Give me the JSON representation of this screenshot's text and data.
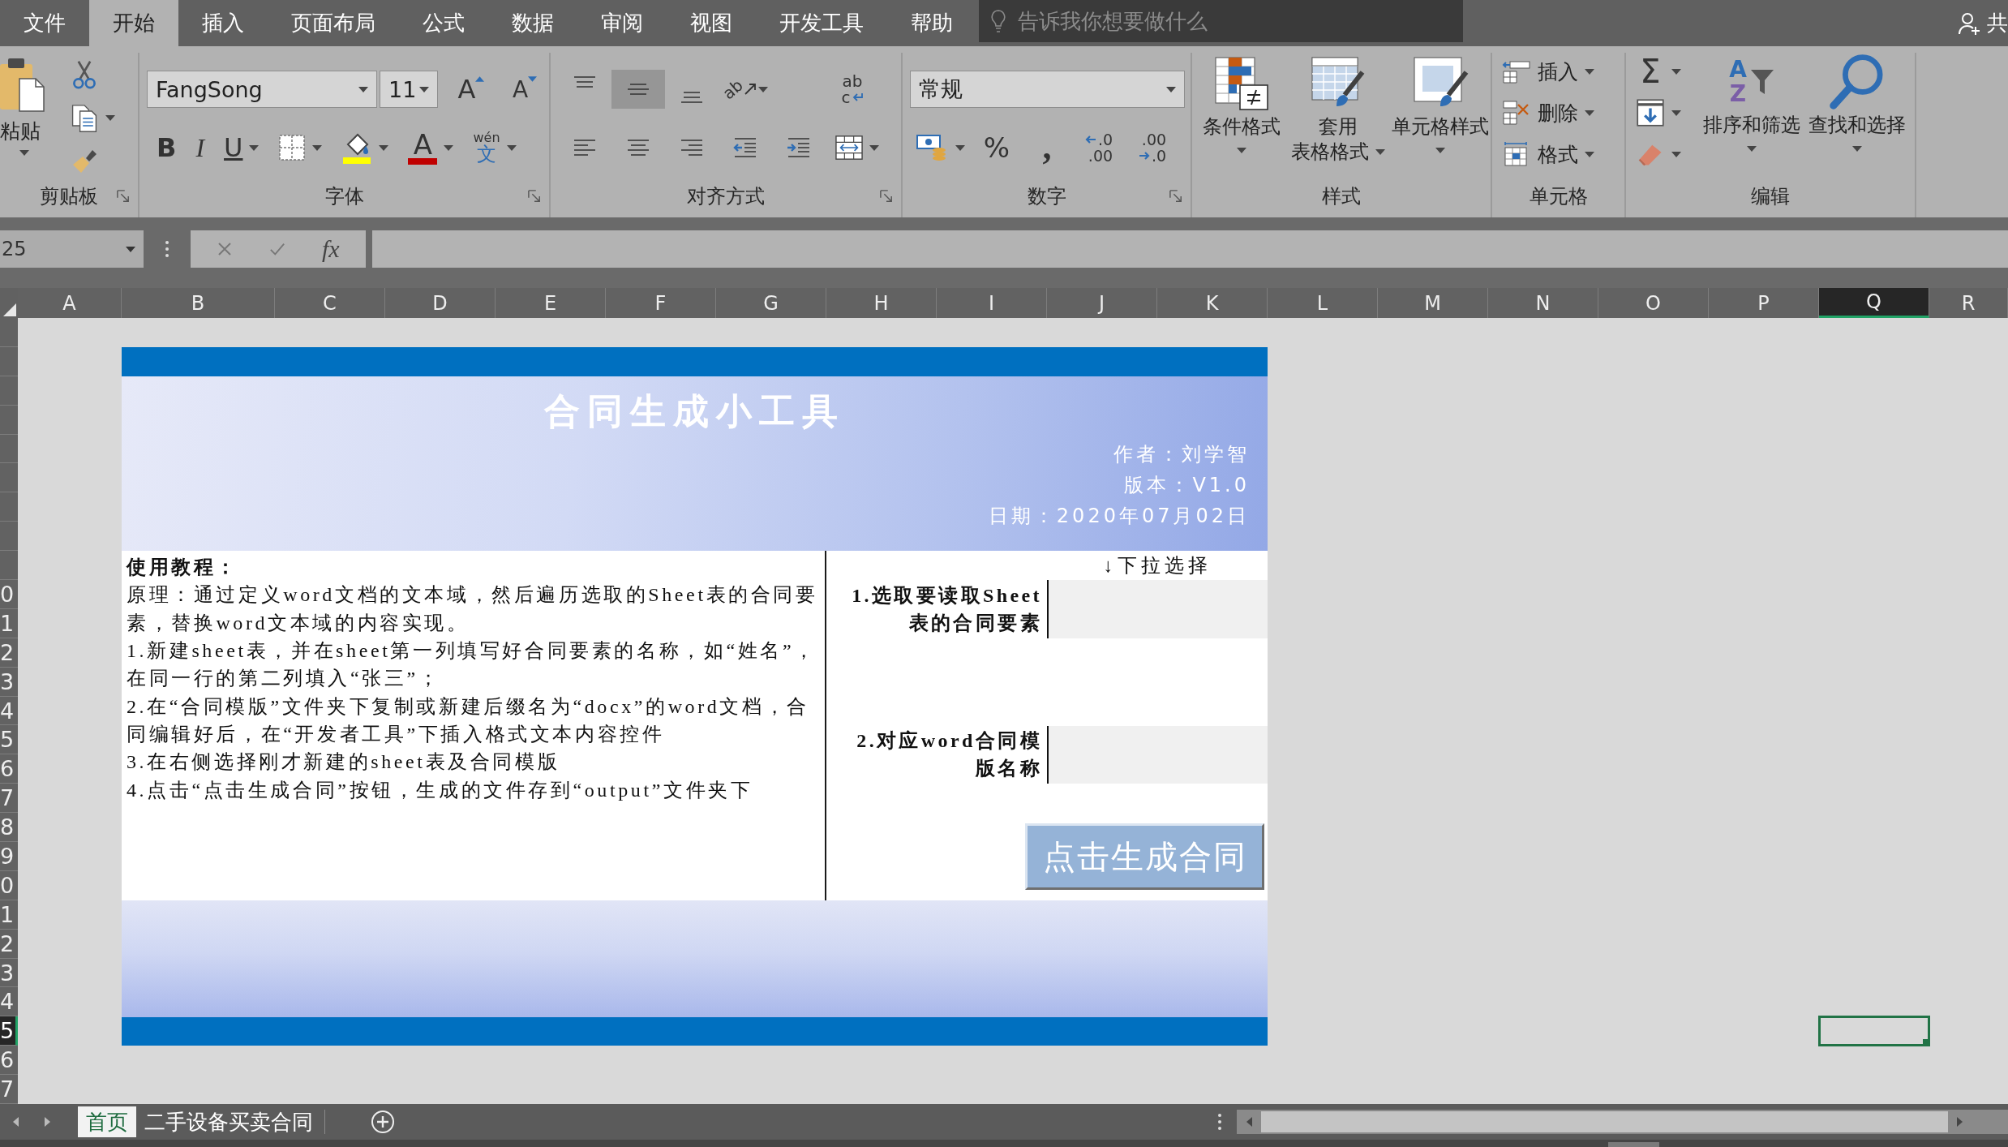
{
  "menu_tabs": [
    {
      "label": "文件",
      "selected": false
    },
    {
      "label": "开始",
      "selected": true
    },
    {
      "label": "插入",
      "selected": false
    },
    {
      "label": "页面布局",
      "selected": false
    },
    {
      "label": "公式",
      "selected": false
    },
    {
      "label": "数据",
      "selected": false
    },
    {
      "label": "审阅",
      "selected": false
    },
    {
      "label": "视图",
      "selected": false
    },
    {
      "label": "开发工具",
      "selected": false
    },
    {
      "label": "帮助",
      "selected": false
    }
  ],
  "tell_me": {
    "placeholder": "告诉我你想要做什么"
  },
  "share": {
    "label": "共"
  },
  "ribbon": {
    "clipboard": {
      "title": "剪贴板",
      "paste": "粘贴"
    },
    "font": {
      "title": "字体",
      "font_name": "FangSong",
      "font_size": "11",
      "grow": "A",
      "shrink": "A",
      "styles": [
        {
          "kind": "bold",
          "label": "B"
        },
        {
          "kind": "italic",
          "label": "I"
        },
        {
          "kind": "underline",
          "label": "U"
        }
      ],
      "font_color": "A",
      "phonetic": {
        "top": "wén",
        "bottom": "文"
      }
    },
    "alignment": {
      "title": "对齐方式",
      "vertical": [
        {
          "kind": "top",
          "selected": false
        },
        {
          "kind": "middle",
          "selected": true
        },
        {
          "kind": "bottom",
          "selected": false
        }
      ],
      "orientation": "ab",
      "wrap": {
        "top": "ab",
        "bottom": "c"
      }
    },
    "number": {
      "title": "数字",
      "format": "常规",
      "percent": "%",
      "comma": ",",
      "increase_decimal": {
        "top": ".0",
        "bottom": ".00"
      },
      "decrease_decimal": {
        "top": ".00",
        "bottom": ".0"
      }
    },
    "styles": {
      "title": "样式",
      "buttons": [
        {
          "kind": "conditional",
          "lines": [
            "条件格式"
          ]
        },
        {
          "kind": "table",
          "lines": [
            "套用",
            "表格格式"
          ]
        },
        {
          "kind": "cell",
          "lines": [
            "单元格样式"
          ]
        }
      ]
    },
    "cells": {
      "title": "单元格",
      "buttons": [
        {
          "kind": "insert",
          "label": "插入"
        },
        {
          "kind": "delete",
          "label": "删除"
        },
        {
          "kind": "format",
          "label": "格式"
        }
      ]
    },
    "editing": {
      "title": "编辑",
      "sum": "Σ",
      "sort": {
        "label": "排序和筛选",
        "top": "A",
        "bottom": "Z"
      },
      "find": "查找和选择"
    }
  },
  "formula_bar": {
    "name_box": "25",
    "fx": "fx"
  },
  "columns": [
    {
      "label": "A",
      "selected": false
    },
    {
      "label": "B",
      "selected": false
    },
    {
      "label": "C",
      "selected": false
    },
    {
      "label": "D",
      "selected": false
    },
    {
      "label": "E",
      "selected": false
    },
    {
      "label": "F",
      "selected": false
    },
    {
      "label": "G",
      "selected": false
    },
    {
      "label": "H",
      "selected": false
    },
    {
      "label": "I",
      "selected": false
    },
    {
      "label": "J",
      "selected": false
    },
    {
      "label": "K",
      "selected": false
    },
    {
      "label": "L",
      "selected": false
    },
    {
      "label": "M",
      "selected": false
    },
    {
      "label": "N",
      "selected": false
    },
    {
      "label": "O",
      "selected": false
    },
    {
      "label": "P",
      "selected": false
    },
    {
      "label": "Q",
      "selected": true
    },
    {
      "label": "R",
      "selected": false
    }
  ],
  "rows": [
    {
      "selected": false
    },
    {
      "selected": false
    },
    {
      "selected": false
    },
    {
      "selected": false
    },
    {
      "selected": false
    },
    {
      "selected": false
    },
    {
      "selected": false
    },
    {
      "selected": false
    },
    {
      "selected": false
    },
    {
      "label": "0",
      "selected": false
    },
    {
      "label": "1",
      "selected": false
    },
    {
      "label": "2",
      "selected": false
    },
    {
      "label": "3",
      "selected": false
    },
    {
      "label": "4",
      "selected": false
    },
    {
      "label": "5",
      "selected": false
    },
    {
      "label": "6",
      "selected": false
    },
    {
      "label": "7",
      "selected": false
    },
    {
      "label": "8",
      "selected": false
    },
    {
      "label": "9",
      "selected": false
    },
    {
      "label": "0",
      "selected": false
    },
    {
      "label": "1",
      "selected": false
    },
    {
      "label": "2",
      "selected": false
    },
    {
      "label": "3",
      "selected": false
    },
    {
      "label": "4",
      "selected": false
    },
    {
      "label": "5",
      "selected": true
    },
    {
      "label": "6",
      "selected": false
    },
    {
      "label": "7",
      "selected": false
    }
  ],
  "sheet": {
    "title": "合同生成小工具",
    "info": [
      "作者：刘学智",
      "版本：V1.0",
      "日期：2020年07月02日"
    ],
    "tutorial": {
      "heading": "使用教程：",
      "paragraphs": [
        "原理：通过定义word文档的文本域，然后遍历选取的Sheet表的合同要素，替换word文本域的内容实现。",
        "1.新建sheet表，并在sheet第一列填写好合同要素的名称，如“姓名”，在同一行的第二列填入“张三”；",
        "2.在“合同模版”文件夹下复制或新建后缀名为“docx”的word文档，合同编辑好后，在“开发者工具”下插入格式文本内容控件",
        "3.在右侧选择刚才新建的sheet表及合同模版",
        "4.点击“点击生成合同”按钮，生成的文件存到“output”文件夹下"
      ]
    },
    "dropdown_hint": "↓下拉选择",
    "fields": [
      {
        "label_lines": [
          "1.选取要读取Sheet",
          "表的合同要素"
        ]
      },
      {
        "label_lines": [
          "2.对应word合同模",
          "版名称"
        ]
      }
    ],
    "generate_button": "点击生成合同"
  },
  "sheet_tabs": [
    {
      "label": "首页",
      "selected": true
    },
    {
      "label": "二手设备买卖合同",
      "selected": false
    }
  ]
}
